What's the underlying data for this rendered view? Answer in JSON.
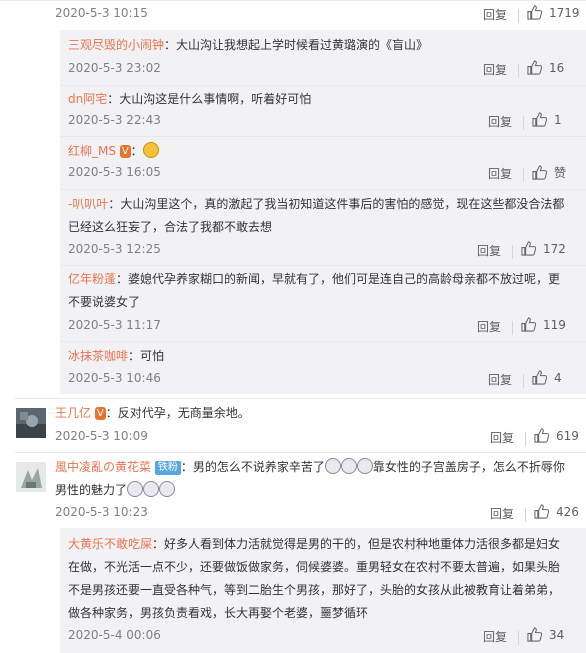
{
  "colors": {
    "name": "#eb7350",
    "time": "#808080",
    "subbg": "#f2f2f5"
  },
  "rows": [
    {
      "time": "2020-5-3 10:15",
      "reply": "回复",
      "likes": "1719"
    },
    {
      "name": "三观尽毁的小闹钟",
      "text": "：大山沟让我想起上学时候看过黄璐演的《盲山》",
      "time": "2020-5-3 23:02",
      "reply": "回复",
      "likes": "16"
    },
    {
      "name": "dn阿宅",
      "text": "：大山沟这是什么事情啊，听着好可怕",
      "time": "2020-5-3 22:43",
      "reply": "回复",
      "likes": "1"
    },
    {
      "name": "红柳_MS",
      "text": "：",
      "time": "2020-5-3 16:05",
      "reply": "回复",
      "likes": "赞"
    },
    {
      "name": "-叭叭叶",
      "text1": "：大山沟里这个，真的激起了我当初知道这件事后的害怕的感觉，现在这些都没合法都",
      "text2": "已经这么狂妄了，合法了我都不敢去想",
      "time": "2020-5-3 12:25",
      "reply": "回复",
      "likes": "172"
    },
    {
      "name": "亿年粉蓬",
      "text1": "：婆媳代孕养家糊口的新闻，早就有了，他们可是连自己的高龄母亲都不放过呢，更",
      "text2": "不要说婆女了",
      "time": "2020-5-3 11:17",
      "reply": "回复",
      "likes": "119"
    },
    {
      "name": "冰抹茶咖啡",
      "text": "：可怕",
      "time": "2020-5-3 10:46",
      "reply": "回复",
      "likes": "4"
    },
    {
      "name": "王几亿",
      "text": "：反对代孕，无商量余地。",
      "time": "2020-5-3 10:09",
      "reply": "回复",
      "likes": "619"
    },
    {
      "name": "風中凌亂の黄花菜",
      "badge": "铁粉",
      "text1": "：男的怎么不说养家辛苦了",
      "text1b": "靠女性的子宫盖房子，怎么不折辱你",
      "text2": "男性的魅力了",
      "time": "2020-5-3 10:23",
      "reply": "回复",
      "likes": "426"
    },
    {
      "name": "大黄乐不敢吃屎",
      "text1": "：好多人看到体力活就觉得是男的干的，但是农村种地重体力活很多都是妇女",
      "text2": "在做，不光活一点不少，还要做饭做家务，伺候婆婆。重男轻女在农村不要太普遍，如果头胎",
      "text3": "不是男孩还要一直受各种气，等到二胎生个男孩，那好了，头胎的女孩从此被教育让着弟弟，",
      "text4": "做各种家务，男孩负责看戏，长大再娶个老婆，噩梦循环",
      "time": "2020-5-4 00:06",
      "reply": "回复",
      "likes": "34"
    }
  ]
}
